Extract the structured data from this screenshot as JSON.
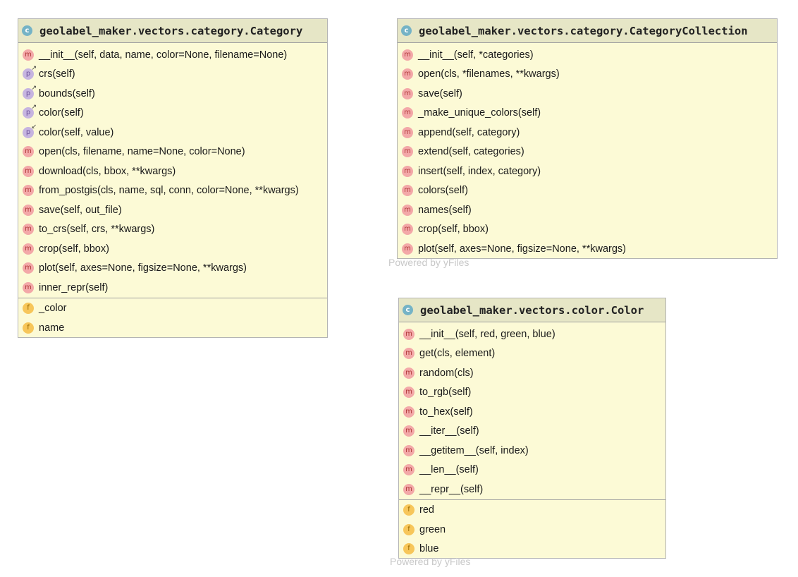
{
  "diagram": {
    "category": {
      "title": "geolabel_maker.vectors.category.Category",
      "class_icon": "c",
      "methods": [
        {
          "icon": "m",
          "kind": "method",
          "text": "__init__(self, data, name, color=None, filename=None)"
        },
        {
          "icon": "p",
          "kind": "getter",
          "text": "crs(self)"
        },
        {
          "icon": "p",
          "kind": "getter",
          "text": "bounds(self)"
        },
        {
          "icon": "p",
          "kind": "getter",
          "text": "color(self)"
        },
        {
          "icon": "p",
          "kind": "setter",
          "text": "color(self, value)"
        },
        {
          "icon": "m",
          "kind": "method",
          "text": "open(cls, filename, name=None, color=None)"
        },
        {
          "icon": "m",
          "kind": "method",
          "text": "download(cls, bbox, **kwargs)"
        },
        {
          "icon": "m",
          "kind": "method",
          "text": "from_postgis(cls, name, sql, conn, color=None, **kwargs)"
        },
        {
          "icon": "m",
          "kind": "method",
          "text": "save(self, out_file)"
        },
        {
          "icon": "m",
          "kind": "method",
          "text": "to_crs(self, crs, **kwargs)"
        },
        {
          "icon": "m",
          "kind": "method",
          "text": "crop(self, bbox)"
        },
        {
          "icon": "m",
          "kind": "method",
          "text": "plot(self, axes=None, figsize=None, **kwargs)"
        },
        {
          "icon": "m",
          "kind": "method",
          "text": "inner_repr(self)"
        }
      ],
      "fields": [
        {
          "icon": "f",
          "text": "_color"
        },
        {
          "icon": "f",
          "text": "name"
        }
      ]
    },
    "collection": {
      "title": "geolabel_maker.vectors.category.CategoryCollection",
      "class_icon": "c",
      "methods": [
        {
          "icon": "m",
          "kind": "method",
          "text": "__init__(self, *categories)"
        },
        {
          "icon": "m",
          "kind": "method",
          "text": "open(cls, *filenames, **kwargs)"
        },
        {
          "icon": "m",
          "kind": "method",
          "text": "save(self)"
        },
        {
          "icon": "m",
          "kind": "method",
          "text": "_make_unique_colors(self)"
        },
        {
          "icon": "m",
          "kind": "method",
          "text": "append(self, category)"
        },
        {
          "icon": "m",
          "kind": "method",
          "text": "extend(self, categories)"
        },
        {
          "icon": "m",
          "kind": "method",
          "text": "insert(self, index, category)"
        },
        {
          "icon": "m",
          "kind": "method",
          "text": "colors(self)"
        },
        {
          "icon": "m",
          "kind": "method",
          "text": "names(self)"
        },
        {
          "icon": "m",
          "kind": "method",
          "text": "crop(self, bbox)"
        },
        {
          "icon": "m",
          "kind": "method",
          "text": "plot(self, axes=None, figsize=None, **kwargs)"
        }
      ],
      "fields": []
    },
    "color": {
      "title": "geolabel_maker.vectors.color.Color",
      "class_icon": "c",
      "methods": [
        {
          "icon": "m",
          "kind": "method",
          "text": "__init__(self, red, green, blue)"
        },
        {
          "icon": "m",
          "kind": "method",
          "text": "get(cls, element)"
        },
        {
          "icon": "m",
          "kind": "method",
          "text": "random(cls)"
        },
        {
          "icon": "m",
          "kind": "method",
          "text": "to_rgb(self)"
        },
        {
          "icon": "m",
          "kind": "method",
          "text": "to_hex(self)"
        },
        {
          "icon": "m",
          "kind": "method",
          "text": "__iter__(self)"
        },
        {
          "icon": "m",
          "kind": "method",
          "text": "__getitem__(self, index)"
        },
        {
          "icon": "m",
          "kind": "method",
          "text": "__len__(self)"
        },
        {
          "icon": "m",
          "kind": "method",
          "text": "__repr__(self)"
        }
      ],
      "fields": [
        {
          "icon": "f",
          "text": "red"
        },
        {
          "icon": "f",
          "text": "green"
        },
        {
          "icon": "f",
          "text": "blue"
        }
      ]
    }
  },
  "watermarks": [
    "Powered by yFiles",
    "Powered by yFiles"
  ],
  "colors": {
    "class_body": "#fcfad6",
    "class_header": "#e6e6c6",
    "class_icon": "#75b3c6",
    "method_icon": "#f3a8a8",
    "property_icon": "#c6b4e0",
    "field_icon": "#f7c65a"
  },
  "icons": {
    "class": "class-icon",
    "method": "method-icon",
    "property": "property-icon",
    "field": "field-icon"
  }
}
